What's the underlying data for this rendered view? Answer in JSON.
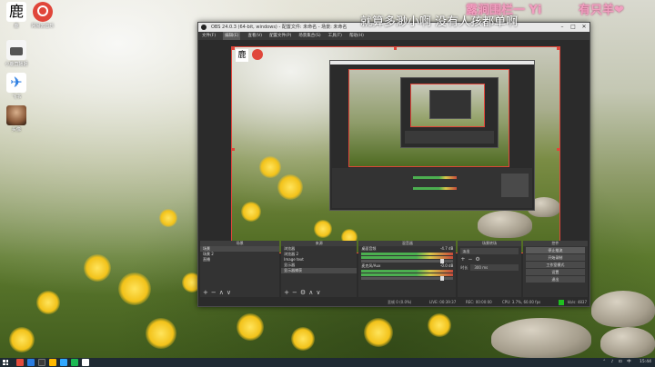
{
  "desktop": {
    "icons": [
      {
        "label": "鹿",
        "sub": "鹿"
      },
      {
        "label": "网易云音乐",
        "sub": "网易云音乐"
      },
      {
        "label": "小鹿直播姬",
        "sub": "小鹿直播姬"
      },
      {
        "label": "飞书",
        "sub": "飞书"
      },
      {
        "label": "头像",
        "sub": "头像"
      }
    ]
  },
  "danmaku": {
    "line1": "就算多渺小啊 没有人孩都单啊",
    "line2": "露涧围栏一 Yi",
    "line3": "有只羊❤"
  },
  "obs": {
    "title": "OBS 24.0.3 (64-bit, windows) - 配置文件: 未命名 - 场景: 未命名",
    "menu": [
      "文件(F)",
      "编辑(E)",
      "查看(V)",
      "配置文件(P)",
      "场景集合(S)",
      "工具(T)",
      "帮助(H)"
    ],
    "docks": {
      "scenes": {
        "title": "场景",
        "items": [
          "场景",
          "场景 2",
          "直播"
        ]
      },
      "sources": {
        "title": "来源",
        "items": [
          "浏览器",
          "浏览器 2",
          "Image text",
          "显示器",
          "显示器捕获"
        ]
      },
      "mixer": {
        "title": "混音器",
        "channels": [
          {
            "name": "桌面音频",
            "db": "-4.7 dB"
          },
          {
            "name": "麦克风/Aux",
            "db": "-0.0 dB"
          }
        ]
      },
      "transitions": {
        "title": "场景转场",
        "type": "淡出",
        "duration_label": "时长",
        "duration": "300 ms"
      },
      "controls": {
        "title": "控件",
        "buttons": [
          "停止推流",
          "开始录制",
          "工作室模式",
          "设置",
          "退出"
        ]
      }
    },
    "status": {
      "dropped": "丢帧 0 (0.0%)",
      "live": "LIVE: 00:39:37",
      "rec": "REC: 00:00:00",
      "cpu": "CPU: 3.7%, 60.00 fps",
      "kbps": "kb/s: 4837"
    }
  },
  "taskbar": {
    "time": "15:44",
    "colors": [
      "#e44b3c",
      "#2b7de1",
      "#3a3a3a",
      "#ffb900",
      "#31a8ff",
      "#1db954",
      "#ffffff"
    ]
  }
}
